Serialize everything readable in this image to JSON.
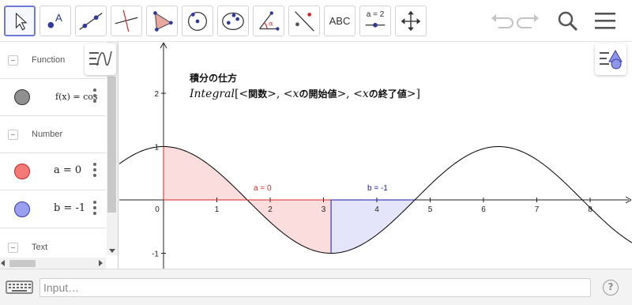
{
  "toolbar": {
    "text_tool_label": "ABC",
    "slider_tool_label": "a = 2"
  },
  "algebra": {
    "groups": {
      "function": "Function",
      "number": "Number",
      "text": "Text"
    },
    "items": {
      "f": {
        "text": "f(x) = cos",
        "color": "#909090"
      },
      "a": {
        "text": "a = 0",
        "color": "#f47a7a"
      },
      "b": {
        "text": "b = -1",
        "color": "#9aa0f0"
      }
    }
  },
  "graphics": {
    "title_cjk": "積分の仕方",
    "syntax": {
      "fn": "Integral",
      "open": "[<",
      "arg1": "関数",
      "sep1": ">, <",
      "var1": "x",
      "arg2": "の開始値",
      "sep2": ">, <",
      "var2": "x",
      "arg3": "の終了値",
      "close": ">]"
    },
    "slider_a_label": "a = 0",
    "slider_b_label": "b = -1",
    "colors": {
      "curve": "#000000",
      "region_a": "#f8b4b4",
      "region_a_edge": "#d62828",
      "region_b": "#c4c4f4",
      "region_b_edge": "#1a1aa8"
    }
  },
  "chart_data": {
    "type": "area",
    "function": "cos(x)",
    "x_ticks": [
      "0",
      "1",
      "2",
      "3",
      "4",
      "5",
      "6",
      "7",
      "8"
    ],
    "y_ticks": [
      "-1",
      "1",
      "2"
    ],
    "xlim": [
      -0.75,
      8.9
    ],
    "ylim": [
      -1.25,
      3.0
    ],
    "shaded_regions": [
      {
        "from": 0,
        "to": 3.1416,
        "color": "#f8b4b4"
      },
      {
        "from": 3.1416,
        "to": 4.7124,
        "color": "#c4c4f4"
      }
    ]
  },
  "input": {
    "placeholder": "Input…"
  }
}
